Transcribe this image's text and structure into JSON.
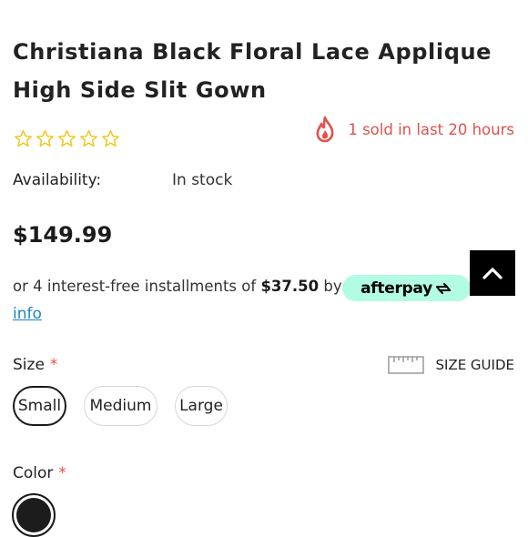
{
  "product": {
    "title": "Christiana Black Floral Lace Applique High Side Slit Gown",
    "rating_stars": 0,
    "rating_max": 5,
    "sold_text": "1 sold in last 20 hours",
    "availability_label": "Availability:",
    "availability_value": "In stock",
    "price": "$149.99"
  },
  "afterpay": {
    "prefix": "or 4 interest-free installments of",
    "amount": "$37.50",
    "by": "by",
    "logo_text": "afterpay",
    "info_link": "info"
  },
  "size": {
    "label": "Size",
    "required_mark": "*",
    "guide_label": "SIZE GUIDE",
    "options": [
      "Small",
      "Medium",
      "Large"
    ],
    "selected": "Small"
  },
  "color": {
    "label": "Color",
    "required_mark": "*",
    "swatches": [
      {
        "value": "#1c1c1c",
        "selected": true
      }
    ]
  },
  "colors": {
    "star": "#f1c40f",
    "sold_accent": "#e0524a",
    "afterpay_mint": "#b2fce4",
    "link": "#1b84c6"
  },
  "icons": {
    "star": "star-outline-icon",
    "flame": "flame-icon",
    "back_to_top": "chevron-up-icon",
    "size_guide": "ruler-icon",
    "afterpay_logo": "afterpay-arrows-icon"
  }
}
